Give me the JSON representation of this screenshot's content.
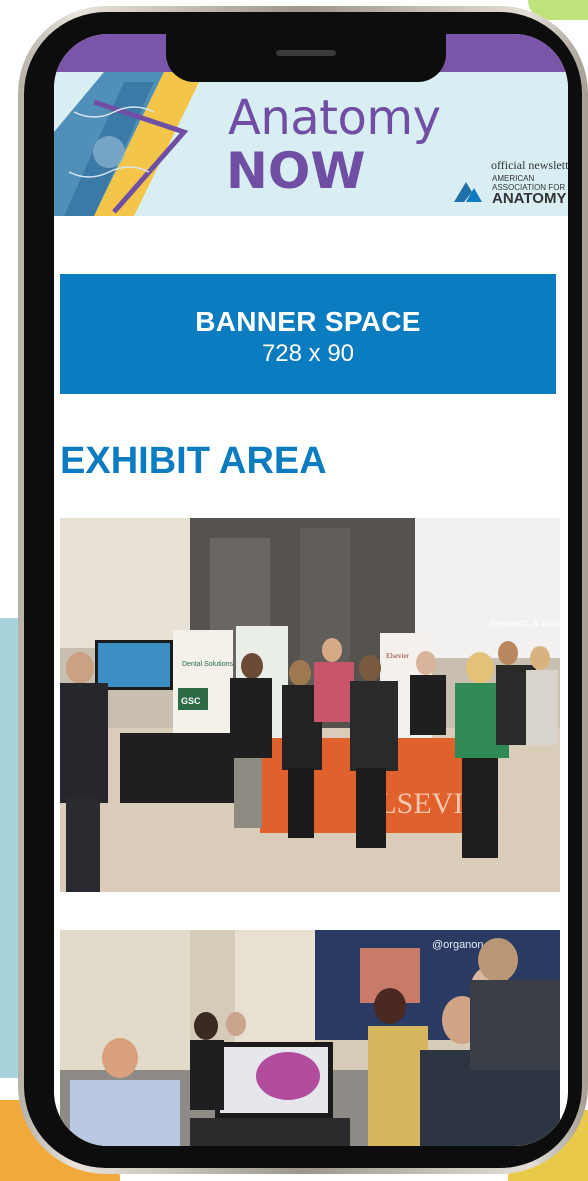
{
  "header": {
    "brand_line1": "Anatomy",
    "brand_line2": "NOW",
    "tagline": "official newsletter",
    "org_line1": "AMERICAN",
    "org_line2": "ASSOCIATION FOR",
    "org_line3": "ANATOMY"
  },
  "banner": {
    "title": "BANNER SPACE",
    "size": "728 x 90"
  },
  "section": {
    "title": "EXHIBIT AREA"
  },
  "photo1": {
    "booth_sign_1": "Dental Solutions",
    "booth_sign_2": "GSC",
    "booth_sign_3": "Elsevier",
    "tablecloth_text": "ELSEVIER",
    "wall_sign": "Research, & Education"
  },
  "photo2": {
    "screen_brand": "@organon"
  },
  "colors": {
    "accent_blue": "#0a7cbf",
    "brand_purple": "#6f4ea3",
    "header_bg": "#d9eef2"
  }
}
